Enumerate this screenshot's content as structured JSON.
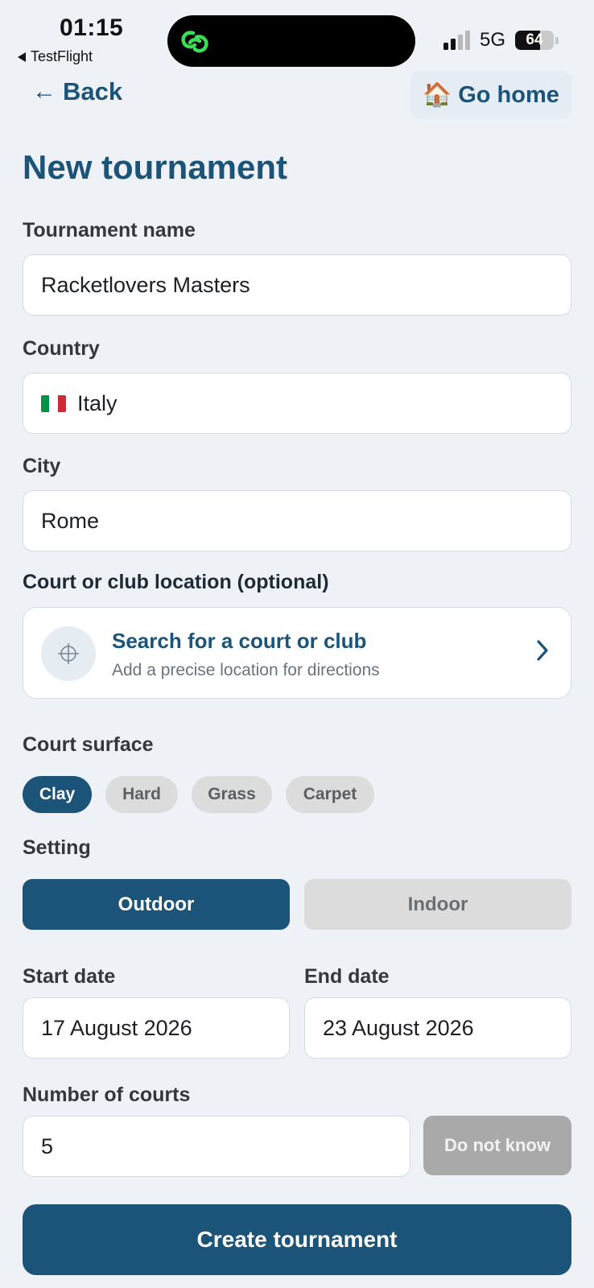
{
  "status_bar": {
    "time": "01:15",
    "back_app": "TestFlight",
    "network": "5G",
    "battery": "64",
    "battery_level": 0.64
  },
  "nav": {
    "back_label": "Back",
    "home_emoji": "🏠",
    "home_label": "Go home"
  },
  "page": {
    "title": "New tournament"
  },
  "form": {
    "name_label": "Tournament name",
    "name_value": "Racketlovers Masters",
    "country_label": "Country",
    "country_value": "Italy",
    "city_label": "City",
    "city_value": "Rome",
    "location_label": "Court or club location (optional)",
    "location_search_title": "Search for a court or club",
    "location_search_subtitle": "Add a precise location for directions",
    "surface_label": "Court surface",
    "surfaces": [
      "Clay",
      "Hard",
      "Grass",
      "Carpet"
    ],
    "surface_selected": "Clay",
    "setting_label": "Setting",
    "settings": [
      "Outdoor",
      "Indoor"
    ],
    "setting_selected": "Outdoor",
    "start_label": "Start date",
    "start_value": "17 August 2026",
    "end_label": "End date",
    "end_value": "23 August 2026",
    "courts_label": "Number of courts",
    "courts_value": "5",
    "dont_know_label": "Do not know",
    "submit_label": "Create tournament"
  },
  "colors": {
    "accent": "#1c5479",
    "background": "#eef1f6",
    "chip_inactive": "#dcdcdc",
    "disabled_button": "#a9a9a9",
    "flag_green": "#009246",
    "flag_white": "#ffffff",
    "flag_red": "#ce2b37"
  },
  "icons": {
    "status_app": "app-link-icon",
    "back": "arrow-left-icon",
    "location": "crosshair-icon",
    "chevron": "chevron-right-icon"
  }
}
